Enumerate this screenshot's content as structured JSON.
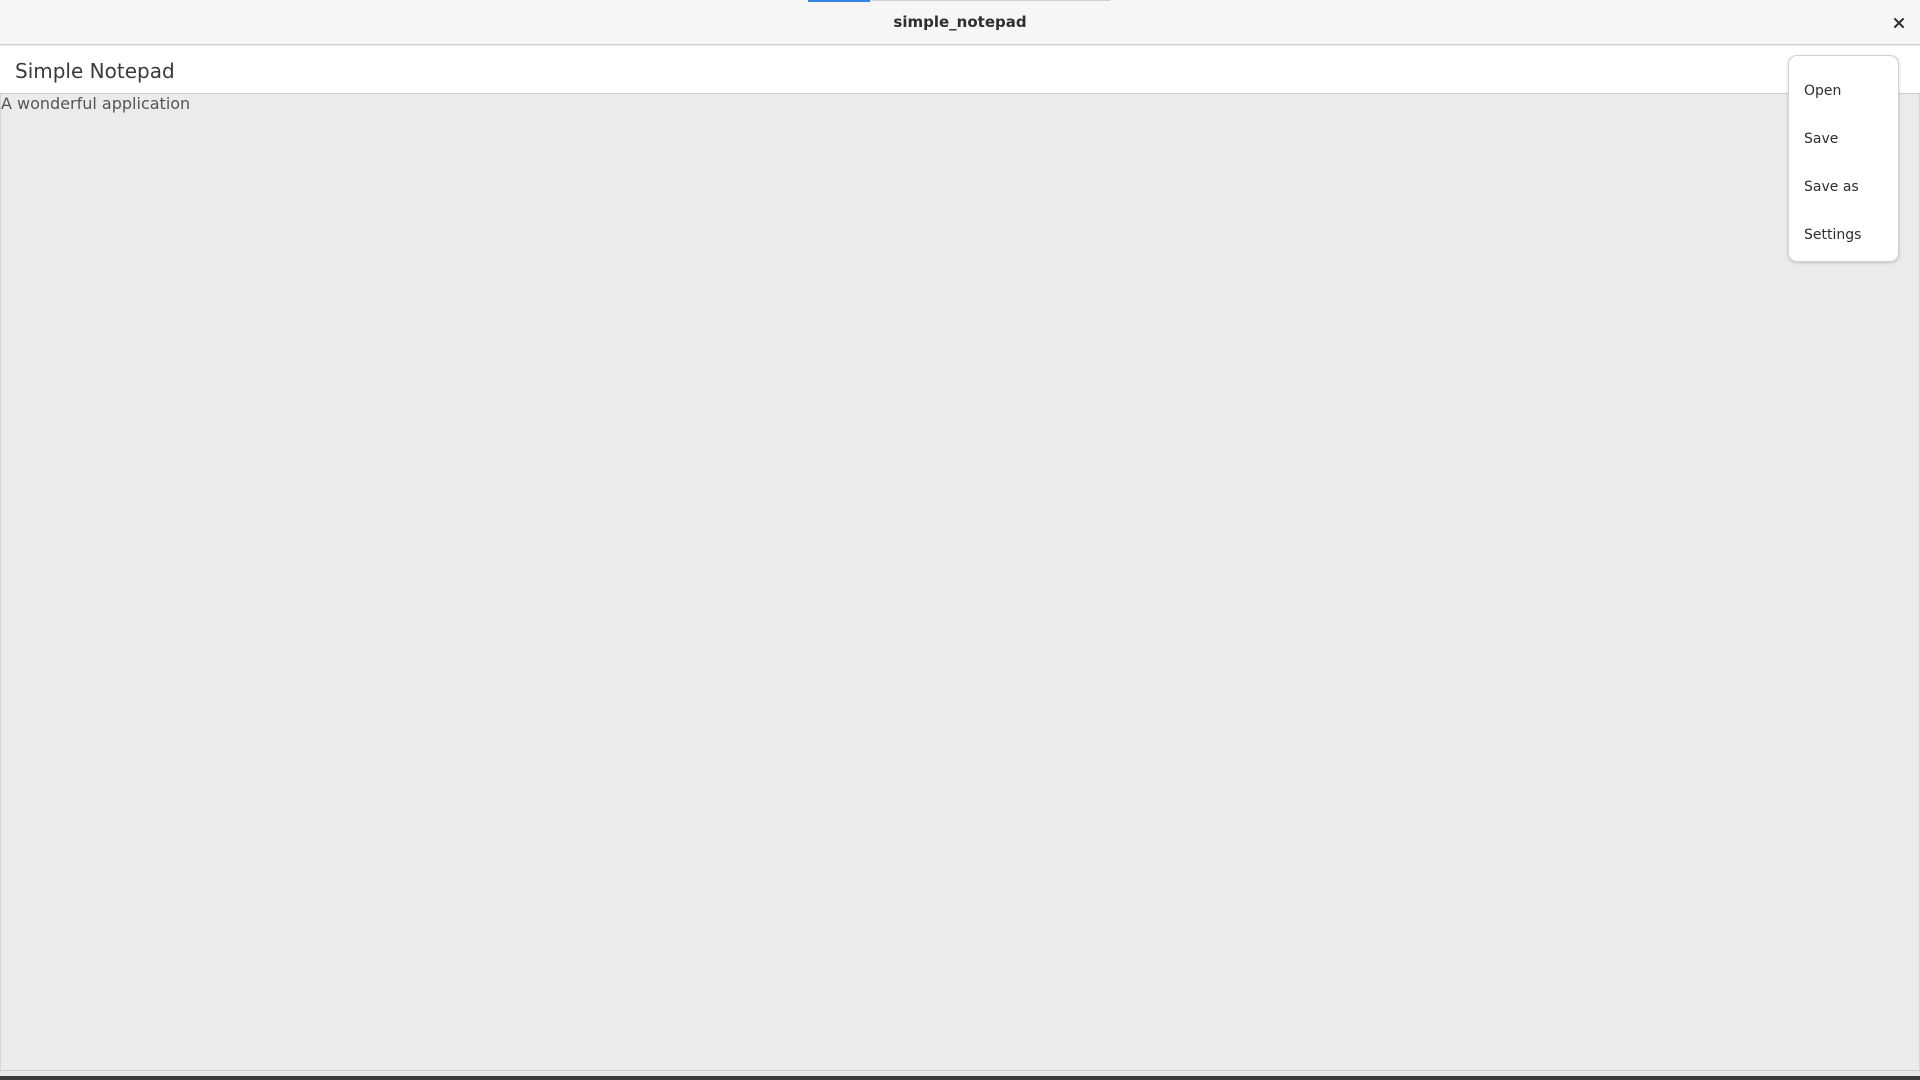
{
  "window": {
    "title": "simple_notepad",
    "close_icon": "close-icon"
  },
  "appbar": {
    "title": "Simple Notepad"
  },
  "content": {
    "subtitle": "A wonderful application"
  },
  "menu": {
    "items": [
      {
        "label": "Open"
      },
      {
        "label": "Save"
      },
      {
        "label": "Save as"
      },
      {
        "label": "Settings"
      }
    ]
  },
  "colors": {
    "accent": "#3584e4",
    "background": "#ebebeb",
    "surface": "#ffffff"
  }
}
